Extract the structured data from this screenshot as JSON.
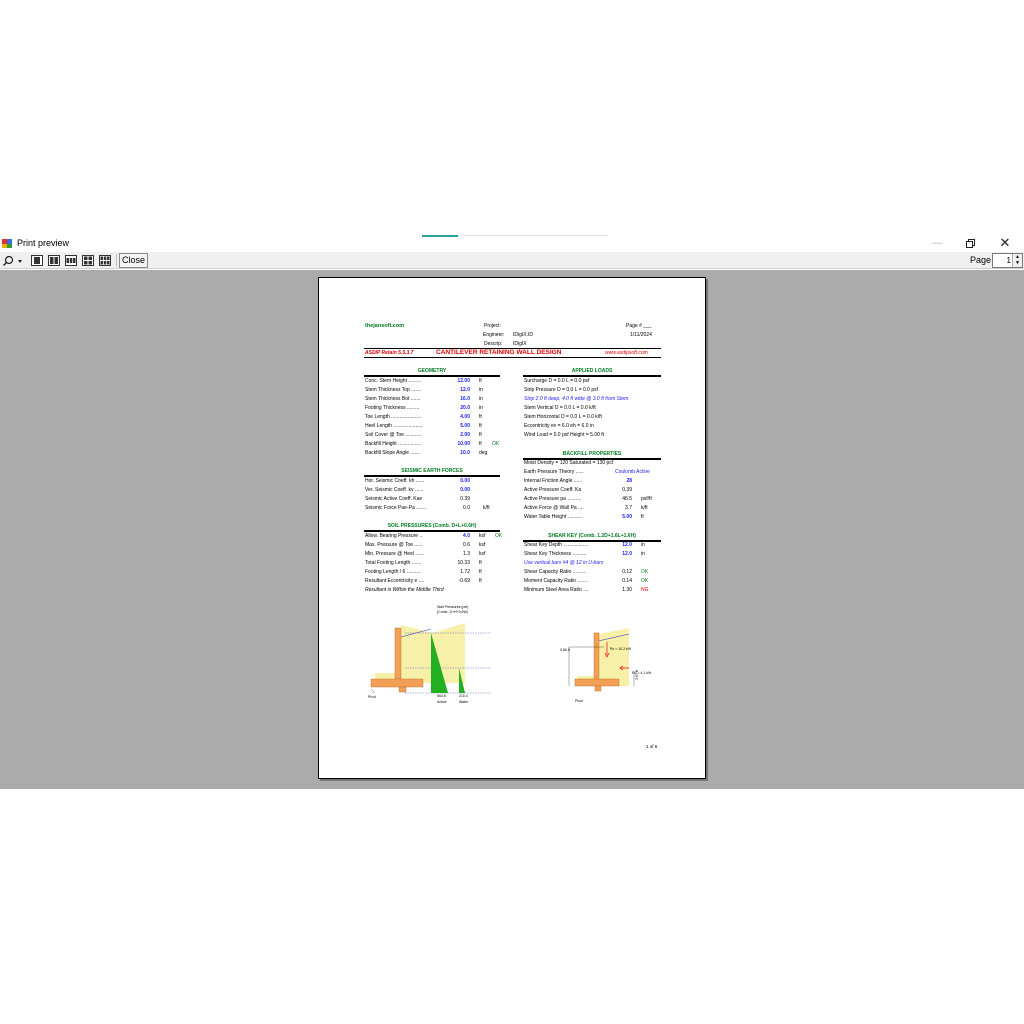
{
  "window": {
    "title": "Print preview"
  },
  "toolbar": {
    "close_label": "Close",
    "page_label": "Page",
    "page_value": "1"
  },
  "doc": {
    "site": "thejansoft.com",
    "project_label": "Project:",
    "engineer_label": "Engineer:",
    "engineer_value": "IDigIX.ID",
    "descrip_label": "Descrip:",
    "descrip_value": "IDigIX",
    "page_label": "Page # ___",
    "date": "1/11/2024",
    "app": "ASDIP Retain 5.5.3.7",
    "main_title": "CANTILEVER RETAINING WALL DESIGN",
    "url": "www.asdipsoft.com",
    "footer": "1 of 6",
    "geometry": {
      "title": "GEOMETRY",
      "rows": [
        {
          "label": "Conc. Stem Height  .........",
          "value": "12.00",
          "unit": "ft",
          "note": ""
        },
        {
          "label": "Stem Thickness Top  .......",
          "value": "12.0",
          "unit": "in",
          "note": ""
        },
        {
          "label": "Stem Thickness Bot  .......",
          "value": "16.0",
          "unit": "in",
          "note": ""
        },
        {
          "label": "Footing Thickness  .........",
          "value": "20.0",
          "unit": "in",
          "note": ""
        },
        {
          "label": "Toe Length  ......................",
          "value": "4.00",
          "unit": "ft",
          "note": ""
        },
        {
          "label": "Heel Length  .....................",
          "value": "5.00",
          "unit": "ft",
          "note": ""
        },
        {
          "label": "Soil Cover @ Toe  ............",
          "value": "2.00",
          "unit": "ft",
          "note": ""
        },
        {
          "label": "Backfill Height  .................",
          "value": "10.00",
          "unit": "ft",
          "note": "OK"
        },
        {
          "label": "Backfill Slope Angle  .......",
          "value": "10.0",
          "unit": "deg",
          "note": ""
        }
      ]
    },
    "seismic": {
      "title": "SEISMIC EARTH FORCES",
      "rows": [
        {
          "label": "Hor. Seismic Coeff. kh  ......",
          "value": "0.00",
          "unit": ""
        },
        {
          "label": "Ver. Seismic Coeff. kv  ......",
          "value": "0.00",
          "unit": ""
        },
        {
          "label": "Seismic Active Coeff. Kae",
          "value": "0.39",
          "unit": ""
        },
        {
          "label": "Seismic Force Pae-Pa  .......",
          "value": "0.0",
          "unit": "k/ft"
        }
      ]
    },
    "soil": {
      "title": "SOIL PRESSURES  (Comb. D+L+0.6H)",
      "rows": [
        {
          "label": "Allow. Bearing Pressure  ..",
          "value": "4.0",
          "unit": "ksf",
          "note": "OK"
        },
        {
          "label": "Max. Pressure @ Toe  ......",
          "value": "0.6",
          "unit": "ksf",
          "note": ""
        },
        {
          "label": "Min. Pressure @ Heel  ......",
          "value": "1.3",
          "unit": "ksf",
          "note": ""
        },
        {
          "label": "Total Footing Length  .......",
          "value": "10.33",
          "unit": "ft",
          "note": ""
        },
        {
          "label": "Footing Length / 6  ..........",
          "value": "1.72",
          "unit": "ft",
          "note": ""
        },
        {
          "label": "Resultant Eccentricity e  ....",
          "value": "-0.69",
          "unit": "ft",
          "note": ""
        }
      ],
      "note": "Resultant is Within the Middle Third"
    },
    "applied": {
      "title": "APPLIED LOADS",
      "surcharge": "Surcharge       D =   0.0       L =   0.0  psf",
      "strip": "Strip Pressure  D =   0.0       L =   0.0  psf",
      "strip_note": "Strip 2.0 ft deep,  4.0 ft wide @ 3.0 ft from Stem",
      "stem_vert": "Stem Vertical     D =   0.0   L =   0.0  k/ft",
      "stem_hor": "Stem Horizontal  D =   0.0   L =   0.0  k/ft",
      "ecc": "Eccentricity  ev =   6.0          eh =   6.0   in",
      "wind": "Wind Load =   0.0   psf      Height =   5.00  ft"
    },
    "backfill": {
      "title": "BACKFILL PROPERTIES",
      "density": "Moist Density =   120    Saturated =   130  pcf",
      "theory_label": "Earth Pressure Theory  ......",
      "theory_value": "Coulomb Active",
      "rows": [
        {
          "label": "Internal Friction Angle  ......",
          "value": "28",
          "unit": ""
        },
        {
          "label": "Active Pressure Coeff. Ka",
          "value": "0.39",
          "unit": ""
        },
        {
          "label": "Active Pressure pa  ..........",
          "value": "46.5",
          "unit": "psf/ft"
        },
        {
          "label": "Active Force @ Wall Pa  ....",
          "value": "3.7",
          "unit": "k/ft"
        },
        {
          "label": "Water Table Height  ...........",
          "value": "5.00",
          "unit": "ft"
        }
      ]
    },
    "shear": {
      "title": "SHEAR KEY  (Comb. 1.2D+1.6L+1.6H)",
      "rows": [
        {
          "label": "Shear Key Depth  ..................",
          "value": "12.0",
          "unit": "in",
          "note": ""
        },
        {
          "label": "Shear Key Thickness  ..........",
          "value": "12.0",
          "unit": "in",
          "note": ""
        }
      ],
      "bars_note": "Use vertical bars  #4 @ 12 in U-bars",
      "rows2": [
        {
          "label": "Shear Capacity Ratio  .........",
          "value": "0.12",
          "unit": "",
          "note": "OK"
        },
        {
          "label": "Moment Capacity Ratio  .......",
          "value": "0.14",
          "unit": "",
          "note": "OK"
        },
        {
          "label": "Minimum Steel Area Ratio  ....",
          "value": "1.30",
          "unit": "",
          "note": "NG"
        }
      ]
    },
    "figure1": {
      "title": "Wall Pressures (psf)",
      "subtitle": "(Comb. D+H+0.6W)",
      "val_active": "564.5",
      "val_water": "210.4",
      "lbl_active": "Active",
      "lbl_water": "Water",
      "lbl_pivot": "Pivot"
    },
    "figure2": {
      "left_label": "0.86 ft",
      "rv_label": "Rv = 10.2 k/ft",
      "rh_label": "Rh = 4.1 k/ft",
      "side_label": "3.67 ft",
      "lbl_pivot": "Pivot"
    }
  }
}
